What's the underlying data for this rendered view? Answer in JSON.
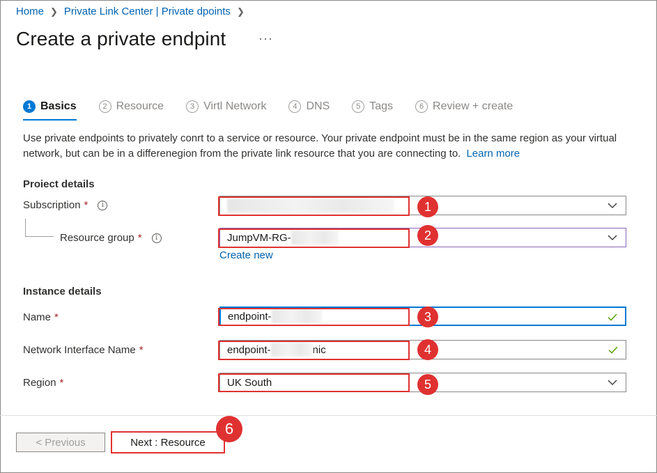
{
  "breadcrumb": {
    "home": "Home",
    "private_link": "Private Link Center | Private dpoints"
  },
  "page": {
    "title": "Create a private endpint",
    "more": "···"
  },
  "tabs": [
    {
      "num": "1",
      "label": "Basics"
    },
    {
      "num": "2",
      "label": "Resource"
    },
    {
      "num": "3",
      "label": "Virtl Network"
    },
    {
      "num": "4",
      "label": "DNS"
    },
    {
      "num": "5",
      "label": "Tags"
    },
    {
      "num": "6",
      "label": "Review + create"
    }
  ],
  "description": {
    "text": "Use private endpoints to privately conrt to a service or resource. Your private endpoint must be in the same region as your virtual network, but can be in a differenegion from the private link resource that you are connecting to.",
    "learn_more": "Learn more"
  },
  "project_details": {
    "heading": "Proiect details",
    "subscription_label": "Subscription",
    "resource_group_label": "Resource group",
    "resource_group_value": "JumpVM-RG-",
    "create_new": "Create new"
  },
  "instance_details": {
    "heading": "Instance details",
    "name_label": "Name",
    "name_value": "endpoint-",
    "nic_label": "Network Interface Name",
    "nic_value_prefix": "endpoint-",
    "nic_value_suffix": "nic",
    "region_label": "Region",
    "region_value": "UK South"
  },
  "required_mark": "*",
  "info_glyph": "i",
  "annotations": [
    "1",
    "2",
    "3",
    "4",
    "5",
    "6"
  ],
  "footer": {
    "previous": "< Previous",
    "next": "Next : Resource"
  },
  "colors": {
    "accent": "#0078d4",
    "link": "#0063b1",
    "highlight": "#e03131",
    "required": "#a4262c",
    "valid": "#57a300"
  }
}
